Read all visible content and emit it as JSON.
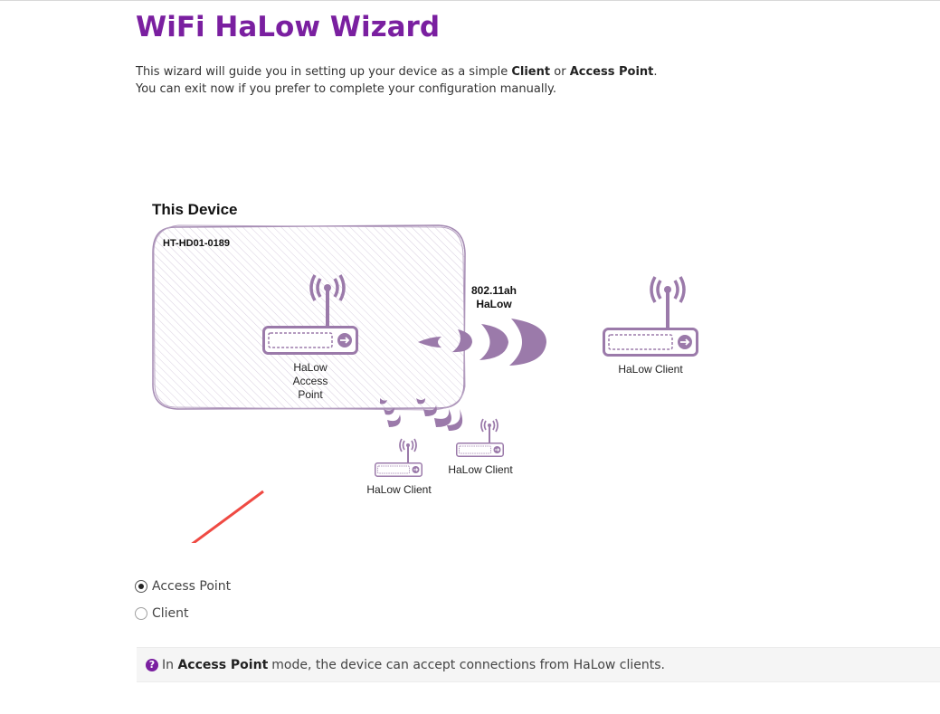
{
  "page": {
    "title": "WiFi HaLow Wizard",
    "intro": {
      "line1_prefix": "This wizard will guide you in setting up your device as a simple ",
      "line1_client": "Client",
      "line1_or": " or ",
      "line1_ap": "Access Point",
      "line1_suffix": ".",
      "line2": "You can exit now if you prefer to complete your configuration manually."
    }
  },
  "diagram": {
    "heading": "This Device",
    "device_name": "HT-HD01-0189",
    "ap_label_1": "HaLow",
    "ap_label_2": "Access",
    "ap_label_3": "Point",
    "link_label_1": "802.11ah",
    "link_label_2": "HaLow",
    "client_right": "HaLow Client",
    "client_small_1": "HaLow Client",
    "client_small_2": "HaLow Client",
    "accent_color": "#9b7aaa"
  },
  "mode": {
    "options": [
      {
        "label": "Access Point",
        "selected": true
      },
      {
        "label": "Client",
        "selected": false
      }
    ]
  },
  "info": {
    "icon": "question-circle-icon",
    "prefix": "In ",
    "mode": "Access Point",
    "suffix": "mode, the device can accept connections from HaLow clients."
  }
}
